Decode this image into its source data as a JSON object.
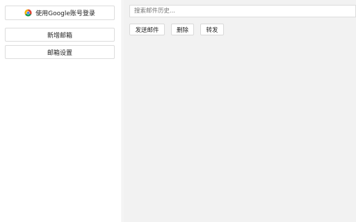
{
  "sidebar": {
    "google_login_label": "使用Google账号登录",
    "google_icon": "chrome-icon",
    "add_mailbox_label": "新增邮箱",
    "mailbox_settings_label": "邮箱设置"
  },
  "main": {
    "search_placeholder": "搜索邮件历史...",
    "actions": {
      "send_label": "发送邮件",
      "delete_label": "删除",
      "forward_label": "转发"
    }
  }
}
